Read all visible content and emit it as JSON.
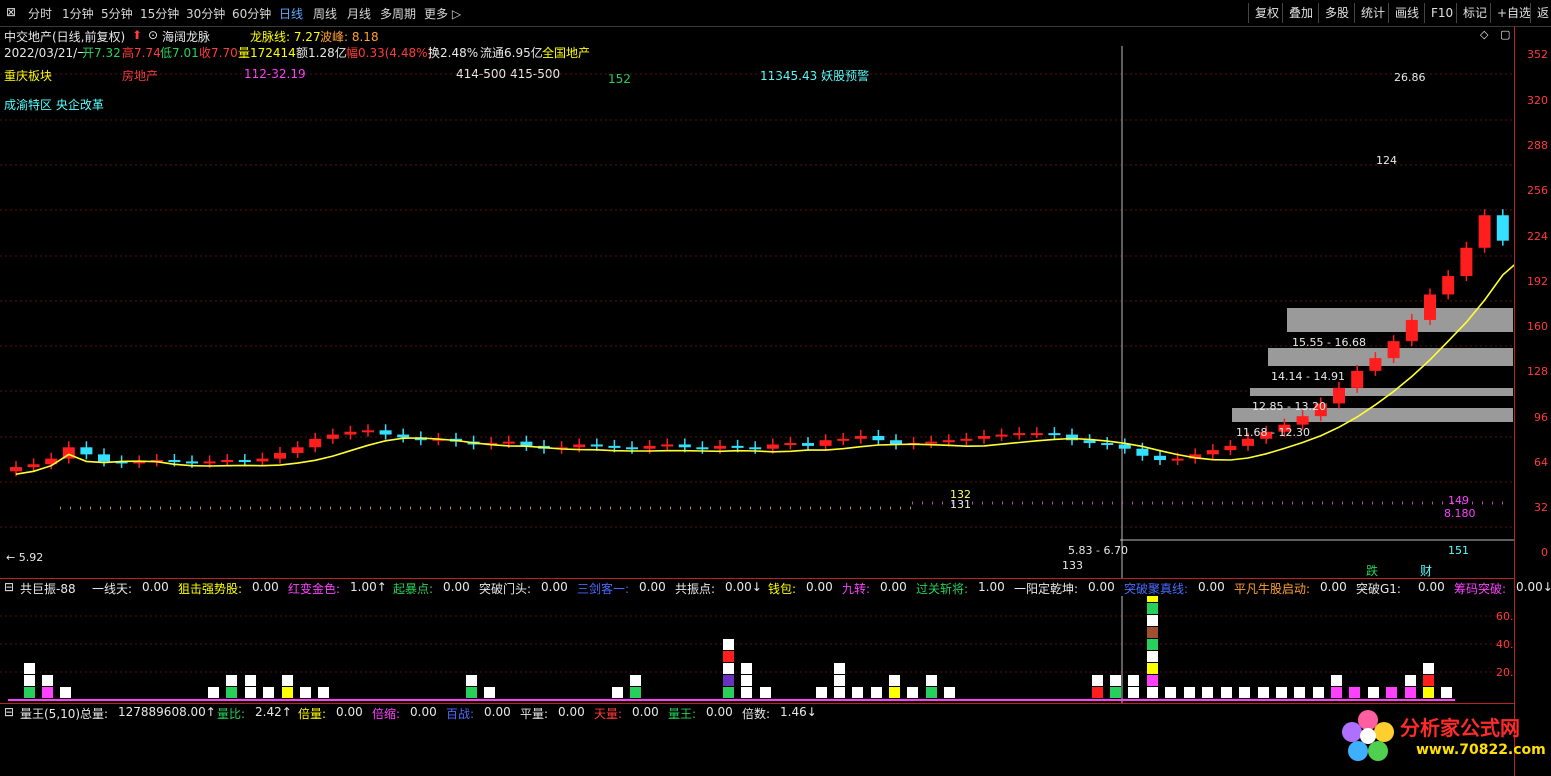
{
  "toolbar": {
    "periods": [
      "分时",
      "1分钟",
      "5分钟",
      "15分钟",
      "30分钟",
      "60分钟",
      "日线",
      "周线",
      "月线",
      "多周期",
      "更多"
    ],
    "active_period": "日线",
    "right_buttons": [
      "复权",
      "叠加",
      "多股",
      "统计",
      "画线",
      "F10",
      "标记",
      "+自选",
      "返"
    ]
  },
  "stock": {
    "name": "中交地产(日线,前复权)",
    "indicator_name": "海阔龙脉",
    "longmai_label": "龙脉线: 7.27",
    "bolang_label": "波峰: 8.18"
  },
  "quote": {
    "date": "2022/03/21/一",
    "open": "开7.32",
    "high": "高7.74",
    "low": "低7.01",
    "close": "收7.70",
    "volume": "量172414",
    "amount": "额1.28亿",
    "change": "幅0.33(4.48%)",
    "turnover": "换2.48%",
    "float": "流通6.95亿",
    "sector": "全国地产"
  },
  "info_row1": {
    "block": "重庆板块",
    "industry": "房地产",
    "code_range": "112-32.19",
    "range2": "414-500 415-500",
    "num": "152",
    "warning": "11345.43 妖股预警"
  },
  "info_row2": {
    "concepts": "成渝特区 央企改革"
  },
  "price_axis": [
    "352",
    "320",
    "288",
    "256",
    "224",
    "192",
    "160",
    "128",
    "96",
    "64",
    "32",
    "0"
  ],
  "chart_labels": {
    "peak": "26.86",
    "mid_high": "124",
    "left_low": "5.92",
    "box1": "15.55 - 16.68",
    "box2": "14.14 - 14.91",
    "box3": "12.85 - 13.20",
    "box4": "11.68 - 12.30",
    "low_range": "5.83 - 6.70",
    "low_num": "133",
    "top_num": "132",
    "top_num2": "131",
    "magenta_num": "149",
    "magenta_val": "8.180",
    "cyan_num": "151",
    "tag_die": "跌",
    "tag_cai": "财"
  },
  "panel2": {
    "title": "共巨振-88",
    "items": [
      {
        "label": "一线天:",
        "value": "0.00",
        "color": "#e8e8e8"
      },
      {
        "label": "狙击强势股:",
        "value": "0.00",
        "color": "#ffff00"
      },
      {
        "label": "红变金色:",
        "value": "1.00↑",
        "color": "#ff40ff"
      },
      {
        "label": "起暴点:",
        "value": "0.00",
        "color": "#27d05a"
      },
      {
        "label": "突破门头:",
        "value": "0.00",
        "color": "#e8e8e8"
      },
      {
        "label": "三剑客一:",
        "value": "0.00",
        "color": "#4a6bff"
      },
      {
        "label": "共振点:",
        "value": "0.00↓",
        "color": "#e8e8e8"
      },
      {
        "label": "钱包:",
        "value": "0.00",
        "color": "#ffff00"
      },
      {
        "label": "九转:",
        "value": "0.00",
        "color": "#ff40ff"
      },
      {
        "label": "过关斩将:",
        "value": "1.00",
        "color": "#27d05a"
      },
      {
        "label": "一阳定乾坤:",
        "value": "0.00",
        "color": "#e8e8e8"
      },
      {
        "label": "突破聚真线:",
        "value": "0.00",
        "color": "#4a6bff"
      },
      {
        "label": "平凡牛股启动:",
        "value": "0.00",
        "color": "#ffa030"
      },
      {
        "label": "突破G1:",
        "value": "0.00",
        "color": "#e8e8e8"
      },
      {
        "label": "筹码突破:",
        "value": "0.00↓",
        "color": "#ff40ff"
      }
    ],
    "axis": [
      "60.",
      "40.",
      "20."
    ]
  },
  "panel3": {
    "title": "量王(5,10)",
    "items": [
      {
        "label": "总量:",
        "value": "127889608.00↑",
        "color": "#e8e8e8"
      },
      {
        "label": "量比:",
        "value": "2.42↑",
        "color": "#27d05a"
      },
      {
        "label": "倍量:",
        "value": "0.00",
        "color": "#ffff00"
      },
      {
        "label": "倍缩:",
        "value": "0.00",
        "color": "#ff40ff"
      },
      {
        "label": "百战:",
        "value": "0.00",
        "color": "#4a6bff"
      },
      {
        "label": "平量:",
        "value": "0.00",
        "color": "#e8e8e8"
      },
      {
        "label": "天量:",
        "value": "0.00",
        "color": "#ff3b3b"
      },
      {
        "label": "量王:",
        "value": "0.00",
        "color": "#27d05a"
      },
      {
        "label": "倍数:",
        "value": "1.46↓",
        "color": "#e8e8e8"
      }
    ]
  },
  "watermark": {
    "brand": "分析家公式网",
    "url": "www.70822.com"
  },
  "colors": {
    "up": "#ff1e1e",
    "down": "#33e0ff",
    "ma": "#ffff33",
    "box": "#9a9a9a",
    "background": "#000000"
  }
}
